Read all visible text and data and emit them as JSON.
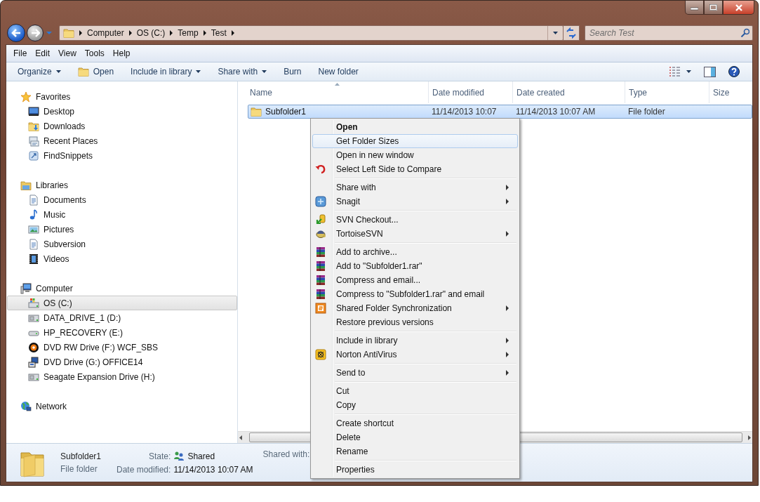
{
  "address_bar": {
    "breadcrumbs": [
      "Computer",
      "OS (C:)",
      "Temp",
      "Test"
    ]
  },
  "search": {
    "placeholder": "Search Test"
  },
  "menu_bar": [
    "File",
    "Edit",
    "View",
    "Tools",
    "Help"
  ],
  "toolbar": [
    {
      "label": "Organize",
      "kind": "dropdown"
    },
    {
      "label": "Open",
      "kind": "folder"
    },
    {
      "label": "Include in library",
      "kind": "dropdown"
    },
    {
      "label": "Share with",
      "kind": "dropdown"
    },
    {
      "label": "Burn",
      "kind": "plain"
    },
    {
      "label": "New folder",
      "kind": "plain"
    }
  ],
  "navigation": [
    {
      "label": "Favorites",
      "kind": "star",
      "selected": false,
      "children": [
        {
          "label": "Desktop",
          "kind": "monitor",
          "selected": false
        },
        {
          "label": "Downloads",
          "kind": "download",
          "selected": false
        },
        {
          "label": "Recent Places",
          "kind": "recent",
          "selected": false
        },
        {
          "label": "FindSnippets",
          "kind": "shortcut",
          "selected": false
        }
      ]
    },
    {
      "label": "Libraries",
      "kind": "library",
      "selected": false,
      "children": [
        {
          "label": "Documents",
          "kind": "document",
          "selected": false
        },
        {
          "label": "Music",
          "kind": "note",
          "selected": false
        },
        {
          "label": "Pictures",
          "kind": "picture",
          "selected": false
        },
        {
          "label": "Subversion",
          "kind": "document",
          "selected": false
        },
        {
          "label": "Videos",
          "kind": "film",
          "selected": false
        }
      ]
    },
    {
      "label": "Computer",
      "kind": "computer",
      "selected": false,
      "children": [
        {
          "label": "OS (C:)",
          "kind": "system",
          "selected": true
        },
        {
          "label": "DATA_DRIVE_1 (D:)",
          "kind": "drive",
          "selected": false
        },
        {
          "label": "HP_RECOVERY (E:)",
          "kind": "hdd",
          "selected": false
        },
        {
          "label": "DVD RW Drive (F:) WCF_SBS",
          "kind": "disc",
          "selected": false
        },
        {
          "label": "DVD Drive (G:) OFFICE14",
          "kind": "setup",
          "selected": false
        },
        {
          "label": "Seagate Expansion Drive (H:)",
          "kind": "drive",
          "selected": false
        }
      ]
    },
    {
      "label": "Network",
      "kind": "globe",
      "selected": false
    }
  ],
  "file_list": {
    "columns": [
      "Name",
      "Date modified",
      "Date created",
      "Type",
      "Size"
    ],
    "rows": [
      {
        "name": "Subfolder1",
        "date_modified": "11/14/2013 10:07",
        "date_created": "11/14/2013 10:07 AM",
        "type": "File folder",
        "selected": true
      }
    ]
  },
  "details_pane": {
    "name": "Subfolder1",
    "type": "File folder",
    "state_label": "State:",
    "state": "Shared",
    "date_label": "Date modified:",
    "date": "11/14/2013 10:07 AM",
    "shared_label": "Shared with:"
  },
  "context_menu": {
    "groups": [
      [
        {
          "label": "Open",
          "kind": "none",
          "default": true,
          "selected": false,
          "submenu": false
        },
        {
          "label": "Get Folder Sizes",
          "kind": "none",
          "default": false,
          "selected": true,
          "submenu": false
        },
        {
          "label": "Open in new window",
          "kind": "none",
          "default": false,
          "selected": false,
          "submenu": false
        },
        {
          "label": "Select Left Side to Compare",
          "kind": "undo",
          "default": false,
          "selected": false,
          "submenu": false
        }
      ],
      [
        {
          "label": "Share with",
          "kind": "none",
          "default": false,
          "selected": false,
          "submenu": true
        },
        {
          "label": "Snagit",
          "kind": "snagit",
          "default": false,
          "selected": false,
          "submenu": true
        }
      ],
      [
        {
          "label": "SVN Checkout...",
          "kind": "checkout",
          "default": false,
          "selected": false,
          "submenu": false
        },
        {
          "label": "TortoiseSVN",
          "kind": "turtle",
          "default": false,
          "selected": false,
          "submenu": true
        }
      ],
      [
        {
          "label": "Add to archive...",
          "kind": "archive",
          "default": false,
          "selected": false,
          "submenu": false
        },
        {
          "label": "Add to \"Subfolder1.rar\"",
          "kind": "archive",
          "default": false,
          "selected": false,
          "submenu": false
        },
        {
          "label": "Compress and email...",
          "kind": "archive",
          "default": false,
          "selected": false,
          "submenu": false
        },
        {
          "label": "Compress to \"Subfolder1.rar\" and email",
          "kind": "archive",
          "default": false,
          "selected": false,
          "submenu": false
        },
        {
          "label": "Shared Folder Synchronization",
          "kind": "sync",
          "default": false,
          "selected": false,
          "submenu": true
        },
        {
          "label": "Restore previous versions",
          "kind": "none",
          "default": false,
          "selected": false,
          "submenu": false
        }
      ],
      [
        {
          "label": "Include in library",
          "kind": "none",
          "default": false,
          "selected": false,
          "submenu": true
        },
        {
          "label": "Norton AntiVirus",
          "kind": "shield",
          "default": false,
          "selected": false,
          "submenu": true
        }
      ],
      [
        {
          "label": "Send to",
          "kind": "none",
          "default": false,
          "selected": false,
          "submenu": true
        }
      ],
      [
        {
          "label": "Cut",
          "kind": "none",
          "default": false,
          "selected": false,
          "submenu": false
        },
        {
          "label": "Copy",
          "kind": "none",
          "default": false,
          "selected": false,
          "submenu": false
        }
      ],
      [
        {
          "label": "Create shortcut",
          "kind": "none",
          "default": false,
          "selected": false,
          "submenu": false
        },
        {
          "label": "Delete",
          "kind": "none",
          "default": false,
          "selected": false,
          "submenu": false
        },
        {
          "label": "Rename",
          "kind": "none",
          "default": false,
          "selected": false,
          "submenu": false
        }
      ],
      [
        {
          "label": "Properties",
          "kind": "none",
          "default": false,
          "selected": false,
          "submenu": false
        }
      ]
    ]
  }
}
